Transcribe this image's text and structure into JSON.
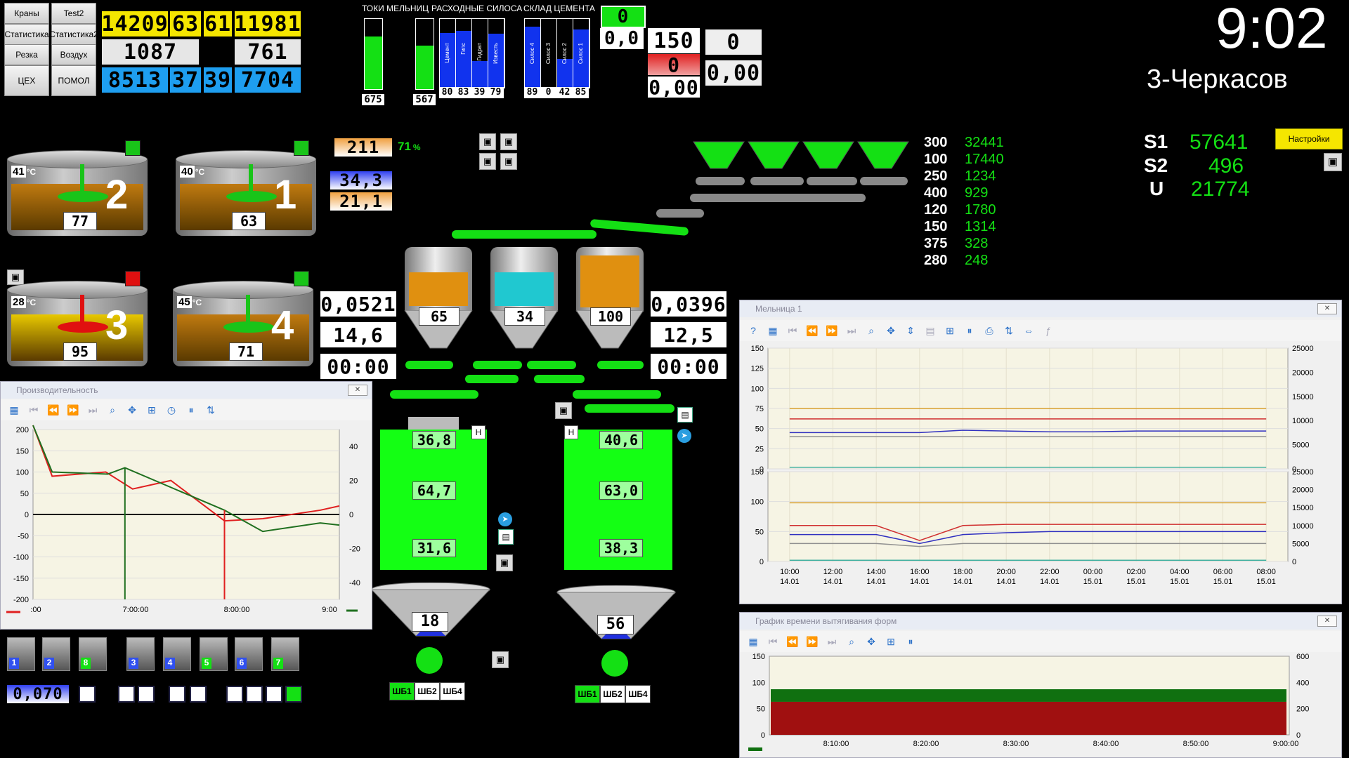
{
  "nav": [
    "Краны",
    "Test2",
    "Статистика",
    "Статистика2",
    "Резка",
    "Воздух",
    "ЦЕХ",
    "ПОМОЛ"
  ],
  "top_values": {
    "row1": [
      "14209",
      "63",
      "61",
      "11981"
    ],
    "row2": [
      "1087",
      "761"
    ],
    "row3": [
      "8513",
      "37",
      "39",
      "7704"
    ]
  },
  "mill_currents": {
    "title": "ТОКИ МЕЛЬНИЦ",
    "values": [
      "675",
      "567"
    ],
    "levels": [
      0.75,
      0.62
    ]
  },
  "consumption_silos": {
    "title": "РАСХОДНЫЕ СИЛОСА",
    "names": [
      "Цемент",
      "Гипс",
      "Гидрат",
      "Известь"
    ],
    "values": [
      "80",
      "83",
      "39",
      "79"
    ],
    "levels": [
      0.8,
      0.83,
      0.39,
      0.79
    ]
  },
  "cement_store": {
    "title": "СКЛАД ЦЕМЕНТА",
    "names": [
      "Силос 4",
      "Силос 3",
      "Силос 2",
      "Силос 1"
    ],
    "values": [
      "89",
      "0",
      "42",
      "85"
    ],
    "levels": [
      0.89,
      0.0,
      0.42,
      0.85
    ]
  },
  "misc_values": {
    "green_zero": "0",
    "a": "0,0",
    "b": "150",
    "c": "0",
    "d": "0",
    "e": "0,00",
    "f": "0,00"
  },
  "clock": "9:02",
  "shift": "3-Черкасов",
  "settings_button": "Настройки",
  "stats": [
    {
      "label": "S1",
      "value": "57641"
    },
    {
      "label": "S2",
      "value": "496"
    },
    {
      "label": "U",
      "value": "21774"
    }
  ],
  "form_table": [
    [
      "300",
      "32441"
    ],
    [
      "100",
      "17440"
    ],
    [
      "250",
      "1234"
    ],
    [
      "400",
      "929"
    ],
    [
      "120",
      "1780"
    ],
    [
      "150",
      "1314"
    ],
    [
      "375",
      "328"
    ],
    [
      "280",
      "248"
    ]
  ],
  "tanks": [
    {
      "id": "2",
      "temp": "41",
      "level": "77",
      "status": "#19c419",
      "mixer": "#19c419",
      "fill": "#c07a10"
    },
    {
      "id": "1",
      "temp": "40",
      "level": "63",
      "status": "#19c419",
      "mixer": "#19c419",
      "fill": "#c07a10"
    },
    {
      "id": "3",
      "temp": "28",
      "level": "95",
      "status": "#e01010",
      "mixer": "#e01010",
      "fill": "#e8c800"
    },
    {
      "id": "4",
      "temp": "45",
      "level": "71",
      "status": "#19c419",
      "mixer": "#19c419",
      "fill": "#c07a10"
    }
  ],
  "temp_unit": "°C",
  "mid_values": {
    "v211": "211",
    "pct": "71",
    "pct_unit": "%",
    "v343": "34,3",
    "v211b": "21,1"
  },
  "left_panel": [
    "0,0521",
    "14,6",
    "00:00"
  ],
  "right_panel": [
    "0,0396",
    "12,5",
    "00:00"
  ],
  "hoppers": [
    {
      "value": "65",
      "fill": "#e09010"
    },
    {
      "value": "34",
      "fill": "#20c8d0"
    },
    {
      "value": "100",
      "fill": "#e09010"
    }
  ],
  "mixers": [
    {
      "values": [
        "36,8",
        "64,7",
        "31,6"
      ],
      "marker": "H"
    },
    {
      "values": [
        "40,6",
        "63,0",
        "38,3"
      ],
      "marker": "H"
    }
  ],
  "funnels": [
    {
      "value": "18",
      "buttons": [
        "ШБ1",
        "ШБ2",
        "ШБ4"
      ]
    },
    {
      "value": "56",
      "buttons": [
        "ШБ1",
        "ШБ2",
        "ШБ4"
      ]
    }
  ],
  "machines": [
    "1",
    "2",
    "8",
    "3",
    "4",
    "5",
    "6",
    "7"
  ],
  "bottom_value": "0,070",
  "perf_chart": {
    "title": "Производительность",
    "chart_data": {
      "type": "line",
      "x_ticks": [
        ":00",
        "7:00:00",
        "8:00:00",
        "9:00"
      ],
      "y_ticks_left": [
        "200",
        "150",
        "100",
        "50",
        "0",
        "-50",
        "-100",
        "-150",
        "-200"
      ],
      "y_ticks_right": [
        "40",
        "20",
        "0",
        "-20",
        "-40"
      ],
      "ylim": [
        -200,
        200
      ],
      "y2lim": [
        -50,
        50
      ],
      "series": [
        {
          "color": "#e02020",
          "points": [
            [
              0,
              210
            ],
            [
              0.1,
              90
            ],
            [
              0.38,
              100
            ],
            [
              0.52,
              60
            ],
            [
              0.72,
              80
            ],
            [
              1.0,
              -15
            ],
            [
              1.2,
              -10
            ],
            [
              1.5,
              10
            ],
            [
              1.6,
              20
            ]
          ]
        },
        {
          "color": "#207020",
          "points": [
            [
              0,
              210
            ],
            [
              0.1,
              100
            ],
            [
              0.39,
              95
            ],
            [
              0.48,
              110
            ],
            [
              1.0,
              10
            ],
            [
              1.2,
              -40
            ],
            [
              1.5,
              -20
            ],
            [
              1.6,
              -25
            ]
          ]
        }
      ]
    }
  },
  "mill_chart": {
    "title": "Мельница 1",
    "chart_data": {
      "type": "line",
      "y_ticks_top": [
        "150",
        "125",
        "100",
        "75",
        "50",
        "25",
        "0"
      ],
      "y_ticks_bottom": [
        "150",
        "100",
        "50",
        "0"
      ],
      "y_ticks_right_top": [
        "25000",
        "20000",
        "15000",
        "10000",
        "5000",
        "0"
      ],
      "y_ticks_right_bottom": [
        "25000",
        "20000",
        "15000",
        "10000",
        "5000",
        "0"
      ],
      "x_ticks": [
        "10:00 14.01",
        "12:00 14.01",
        "14:00 14.01",
        "16:00 14.01",
        "18:00 14.01",
        "20:00 14.01",
        "22:00 14.01",
        "00:00 15.01",
        "02:00 15.01",
        "04:00 15.01",
        "06:00 15.01",
        "08:00 15.01"
      ],
      "x_hours": [
        10,
        12,
        14,
        16,
        18,
        20,
        22,
        24,
        26,
        28,
        30,
        32
      ],
      "top_series": [
        {
          "color": "#d8a030",
          "values": [
            75,
            75,
            75,
            75,
            75,
            75,
            75,
            75,
            75,
            75,
            75,
            75
          ]
        },
        {
          "color": "#d03030",
          "values": [
            62,
            62,
            62,
            62,
            62,
            62,
            62,
            62,
            62,
            62,
            62,
            62
          ]
        },
        {
          "color": "#3030c0",
          "values": [
            45,
            45,
            45,
            45,
            48,
            47,
            46,
            46,
            47,
            47,
            47,
            47
          ]
        },
        {
          "color": "#909090",
          "values": [
            40,
            40,
            40,
            40,
            40,
            40,
            40,
            40,
            40,
            40,
            40,
            40
          ]
        },
        {
          "color": "#40b0a0",
          "values": [
            2,
            2,
            2,
            2,
            2,
            2,
            2,
            2,
            2,
            2,
            2,
            2
          ]
        }
      ],
      "bottom_series": [
        {
          "color": "#d8a030",
          "values": [
            98,
            98,
            98,
            98,
            98,
            98,
            98,
            98,
            98,
            98,
            98,
            98
          ]
        },
        {
          "color": "#d03030",
          "values": [
            60,
            60,
            60,
            35,
            60,
            62,
            62,
            62,
            62,
            62,
            62,
            62
          ]
        },
        {
          "color": "#3030c0",
          "values": [
            45,
            45,
            45,
            30,
            45,
            48,
            50,
            50,
            50,
            50,
            50,
            50
          ]
        },
        {
          "color": "#909090",
          "values": [
            30,
            30,
            30,
            25,
            30,
            30,
            30,
            30,
            30,
            30,
            30,
            30
          ]
        },
        {
          "color": "#40b0a0",
          "values": [
            2,
            2,
            2,
            2,
            2,
            2,
            2,
            2,
            2,
            2,
            2,
            2
          ]
        }
      ]
    }
  },
  "form_chart": {
    "title": "График времени вытягивания форм",
    "chart_data": {
      "type": "area",
      "y_ticks_left": [
        "150",
        "100",
        "50",
        "0"
      ],
      "y_ticks_right": [
        "600",
        "400",
        "200",
        "0"
      ],
      "x_ticks": [
        "8:10:00",
        "8:20:00",
        "8:30:00",
        "8:40:00",
        "8:50:00",
        "9:00:00"
      ],
      "series": [
        {
          "name": "",
          "color": "#a01010",
          "level": 63
        },
        {
          "name": "",
          "color": "#107010",
          "level": 87
        }
      ]
    }
  }
}
